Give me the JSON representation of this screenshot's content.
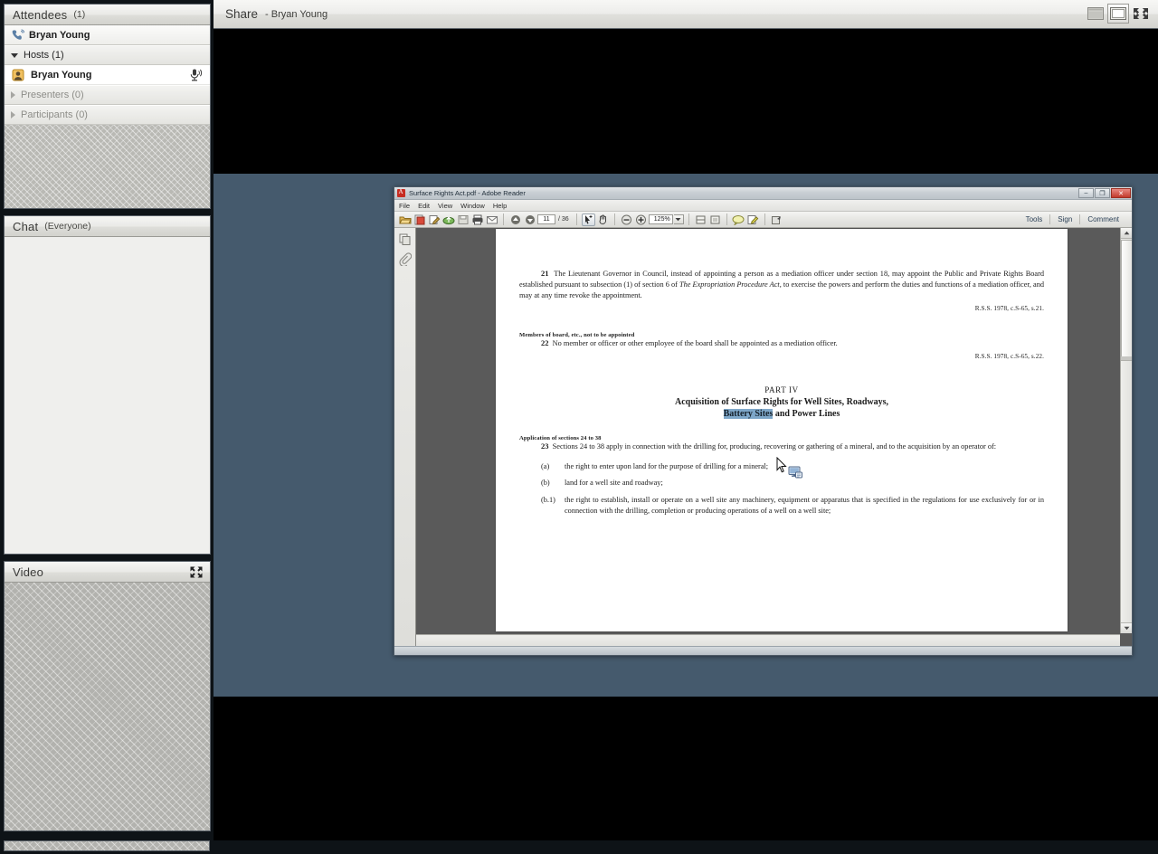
{
  "meeting": {
    "attendees_pod": {
      "title": "Attendees",
      "count": "(1)",
      "self_user": "Bryan Young",
      "groups": [
        {
          "label": "Hosts (1)",
          "expanded": true,
          "members": [
            {
              "name": "Bryan Young",
              "mic": "microphone-icon"
            }
          ]
        },
        {
          "label": "Presenters (0)",
          "expanded": false,
          "members": []
        },
        {
          "label": "Participants (0)",
          "expanded": false,
          "members": []
        }
      ]
    },
    "chat_pod": {
      "title": "Chat",
      "scope": "(Everyone)",
      "messages": []
    },
    "video_pod": {
      "title": "Video",
      "fullscreen_icon": "expand-icon"
    }
  },
  "share": {
    "title": "Share",
    "presenter": "- Bryan Young",
    "buttons": [
      {
        "name": "view-sidebar-icon",
        "label": ""
      },
      {
        "name": "view-full-icon",
        "label": ""
      },
      {
        "name": "fullscreen-icon",
        "label": ""
      }
    ]
  },
  "reader": {
    "window_title": "Surface Rights Act.pdf - Adobe Reader",
    "window_buttons": {
      "minimize": "–",
      "maximize": "❐",
      "close": "✕"
    },
    "menus": [
      "File",
      "Edit",
      "View",
      "Window",
      "Help"
    ],
    "toolbar": {
      "page_current": "11",
      "page_total": "/ 36",
      "zoom_value": "125%",
      "zoom_arrow": "▾",
      "icons": [
        "open-file-icon",
        "save-as-pdf-icon",
        "sign-edit-icon",
        "upload-cloud-icon",
        "save-icon",
        "print-icon",
        "email-icon",
        "previous-page-icon",
        "next-page-icon",
        "select-tool-icon",
        "hand-tool-icon",
        "zoom-out-icon",
        "zoom-in-icon",
        "fit-width-icon",
        "fit-page-icon",
        "comment-balloon-icon",
        "highlight-icon",
        "expand-panel-icon"
      ],
      "right_links": [
        "Tools",
        "Sign",
        "Comment"
      ]
    },
    "nav_pane_icons": [
      "page-thumbnails-icon",
      "attachments-icon"
    ],
    "document": {
      "s21": {
        "number": "21",
        "text_1": "The Lieutenant Governor in Council, instead of appointing a person as a mediation officer under section 18, may appoint the Public and Private Rights Board established pursuant to subsection (1) of section 6 of ",
        "italic_1": "The Expropriation Procedure Act",
        "text_2": ", to exercise the powers and perform the duties and functions of a mediation officer, and may at any time revoke the appointment.",
        "citation": "R.S.S. 1978, c.S-65, s.21."
      },
      "s22": {
        "heading": "Members of board, etc., not to be appointed",
        "number": "22",
        "text": "No member or officer or other employee of the board shall be appointed as a mediation officer.",
        "citation": "R.S.S. 1978, c.S-65, s.22."
      },
      "part": {
        "number": "PART IV",
        "title_line1": "Acquisition of Surface Rights for Well Sites, Roadways,",
        "title_line2_highlight": "Battery Sites",
        "title_line2_rest": " and Power Lines"
      },
      "s23": {
        "heading": "Application of sections 24 to 38",
        "number": "23",
        "text": "Sections 24 to 38 apply in connection with the drilling for, producing, recovering or gathering of a mineral, and to the acquisition by an operator of:",
        "items": [
          {
            "label": "(a)",
            "text": "the right to enter upon land for the purpose of drilling for a mineral;"
          },
          {
            "label": "(b)",
            "text": "land for a well site and roadway;"
          },
          {
            "label": "(b.1)",
            "text": "the right to establish, install or operate on a well site any machinery, equipment or apparatus that is specified in the regulations for use exclusively for or in connection with the drilling, completion or producing operations of a well on a well site;"
          }
        ]
      }
    }
  },
  "cursor": {
    "name": "mouse-pointer",
    "badge": "screen-share-badge-icon"
  },
  "colors": {
    "stage_background": "#455a6d",
    "app_chrome": "#0e1317",
    "selection_highlight": "#7ea7c9",
    "pdf_document_gray": "#5a5a5a"
  }
}
